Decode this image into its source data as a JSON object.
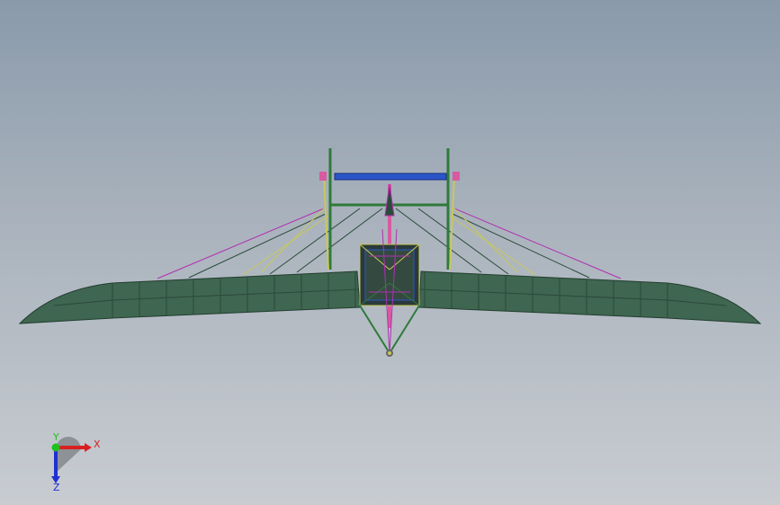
{
  "viewport": {
    "background_top": "#8a9aab",
    "background_bottom": "#c8ccd1"
  },
  "colors": {
    "wing_fill": "#3f6650",
    "wing_rib": "#2a4a3a",
    "strut_green": "#2f7a3a",
    "rod_blue": "#2a55c9",
    "wire_magenta": "#b030b0",
    "wire_yellow": "#c8c85a",
    "joint_pink": "#d85aa0",
    "axis_x": "#d82020",
    "axis_y": "#20c020",
    "axis_z": "#2030d0"
  },
  "triad": {
    "x_label": "X",
    "y_label": "Y",
    "z_label": "Z",
    "x_icon": "axis-x-arrow",
    "y_icon": "axis-y-dot",
    "z_icon": "axis-z-arrow"
  }
}
